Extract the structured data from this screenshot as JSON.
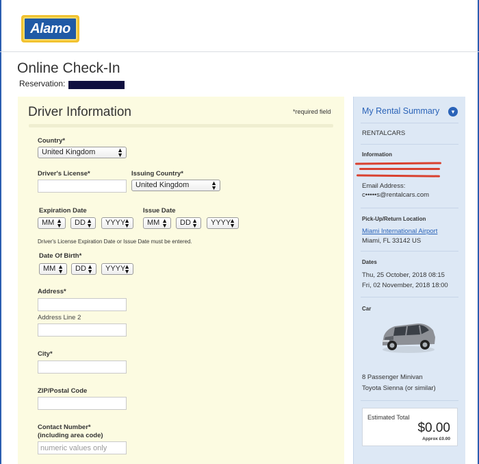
{
  "header": {
    "logo_text": "Alamo"
  },
  "page": {
    "title": "Online Check-In",
    "reservation_label": "Reservation:"
  },
  "driver": {
    "title": "Driver Information",
    "required_note": "*required field",
    "country_label": "Country*",
    "country_value": "United Kingdom",
    "license_label": "Driver's License*",
    "issuing_country_label": "Issuing Country*",
    "issuing_country_value": "United Kingdom",
    "expiration_label": "Expiration Date",
    "issue_label": "Issue Date",
    "mm": "MM",
    "dd": "DD",
    "yyyy": "YYYY",
    "license_note": "Driver's License Expiration Date or Issue Date must be entered.",
    "dob_label": "Date Of Birth*",
    "address_label": "Address*",
    "address2_label": "Address Line 2",
    "city_label": "City*",
    "zip_label": "ZIP/Postal Code",
    "contact_label_1": "Contact Number*",
    "contact_label_2": "(including area code)",
    "contact_placeholder": "numeric values only"
  },
  "summary": {
    "title": "My Rental Summary",
    "provider": "RENTALCARS",
    "information_label": "Information",
    "email_label": "Email Address:",
    "email_value": "c•••••s@rentalcars.com",
    "pickup_label": "Pick-Up/Return Location",
    "pickup_link": "Miami International Airport",
    "pickup_city": "Miami, FL 33142 US",
    "dates_label": "Dates",
    "date_start": "Thu, 25 October, 2018 08:15",
    "date_end": "Fri, 02 November, 2018 18:00",
    "car_label": "Car",
    "car_type": "8 Passenger Minivan",
    "car_model": "Toyota Sienna (or similar)",
    "total_label": "Estimated Total",
    "total_amount": "$0.00",
    "total_approx": "Approx £0.00"
  },
  "colors": {
    "brand_blue": "#2a63b8",
    "form_bg": "#fcfbe1",
    "summary_bg": "#dde8f5",
    "redaction": "#d9412f"
  }
}
